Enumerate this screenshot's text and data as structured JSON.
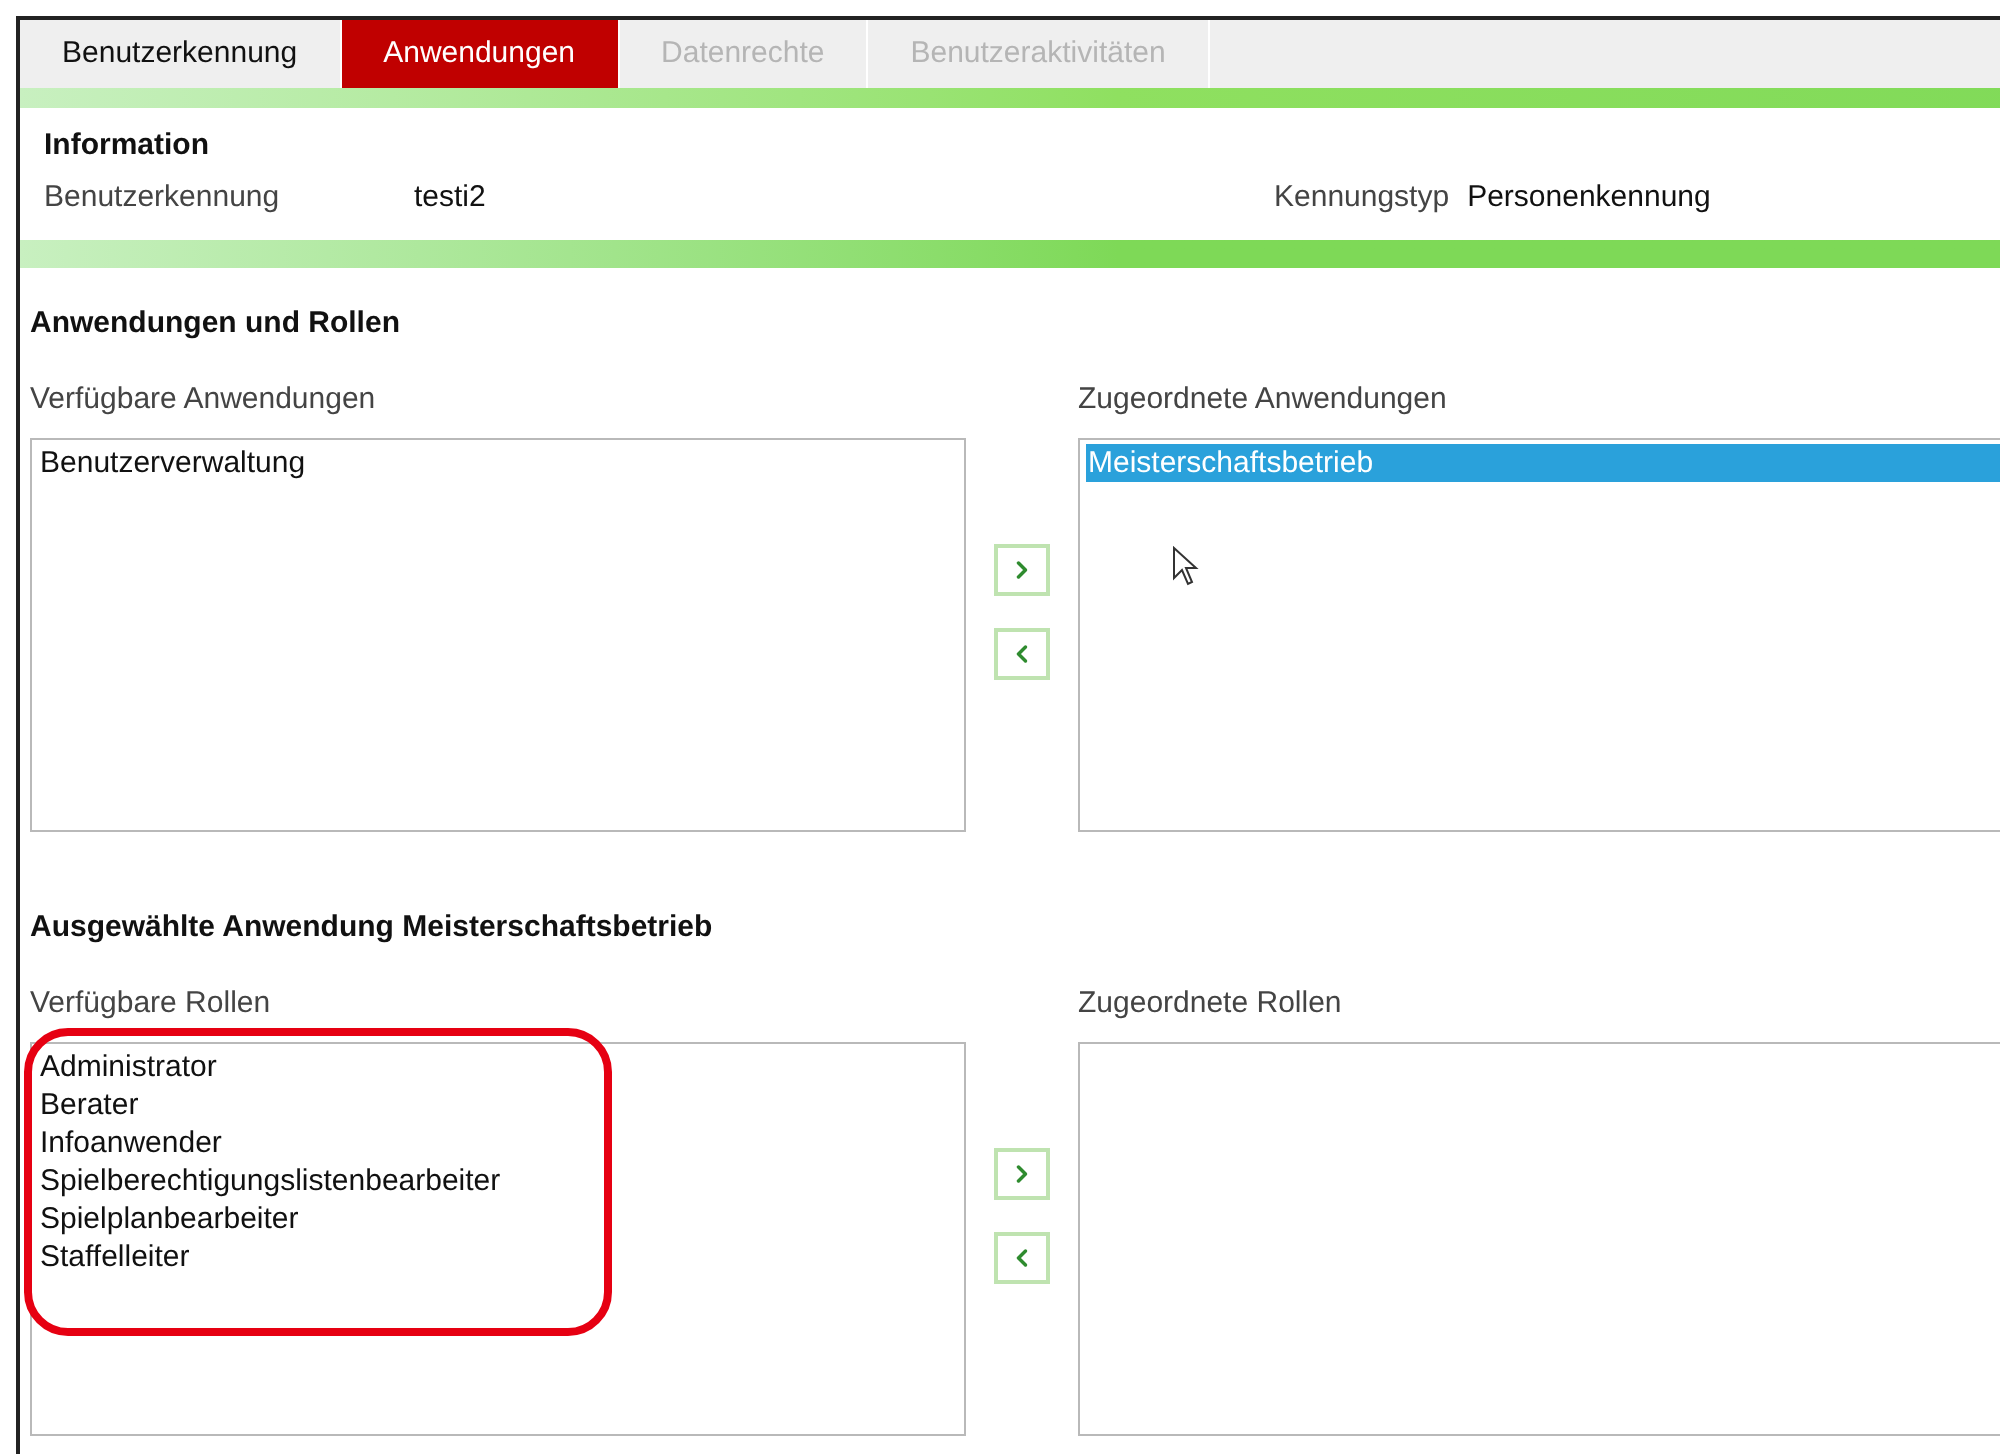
{
  "tabs": [
    {
      "label": "Benutzerkennung",
      "selected": false,
      "disabled": false
    },
    {
      "label": "Anwendungen",
      "selected": true,
      "disabled": false
    },
    {
      "label": "Datenrechte",
      "selected": false,
      "disabled": true
    },
    {
      "label": "Benutzeraktivitäten",
      "selected": false,
      "disabled": true
    }
  ],
  "info": {
    "title": "Information",
    "fields": [
      {
        "label": "Benutzerkennung",
        "value": "testi2"
      },
      {
        "label": "Kennungstyp",
        "value": "Personenkennung"
      }
    ]
  },
  "sections": [
    {
      "title": "Anwendungen und Rollen",
      "available": {
        "label": "Verfügbare Anwendungen",
        "items": [
          {
            "text": "Benutzerverwaltung",
            "selected": false
          }
        ]
      },
      "assigned": {
        "label": "Zugeordnete Anwendungen",
        "items": [
          {
            "text": "Meisterschaftsbetrieb",
            "selected": true
          }
        ]
      },
      "cursor": true
    },
    {
      "title": "Ausgewählte Anwendung Meisterschaftsbetrieb",
      "highlighted": true,
      "available": {
        "label": "Verfügbare Rollen",
        "items": [
          {
            "text": "Administrator",
            "selected": false
          },
          {
            "text": "Berater",
            "selected": false
          },
          {
            "text": "Infoanwender",
            "selected": false
          },
          {
            "text": "Spielberechtigungslistenbearbeiter",
            "selected": false
          },
          {
            "text": "Spielplanbearbeiter",
            "selected": false
          },
          {
            "text": "Staffelleiter",
            "selected": false
          }
        ]
      },
      "assigned": {
        "label": "Zugeordnete Rollen"
      }
    }
  ]
}
